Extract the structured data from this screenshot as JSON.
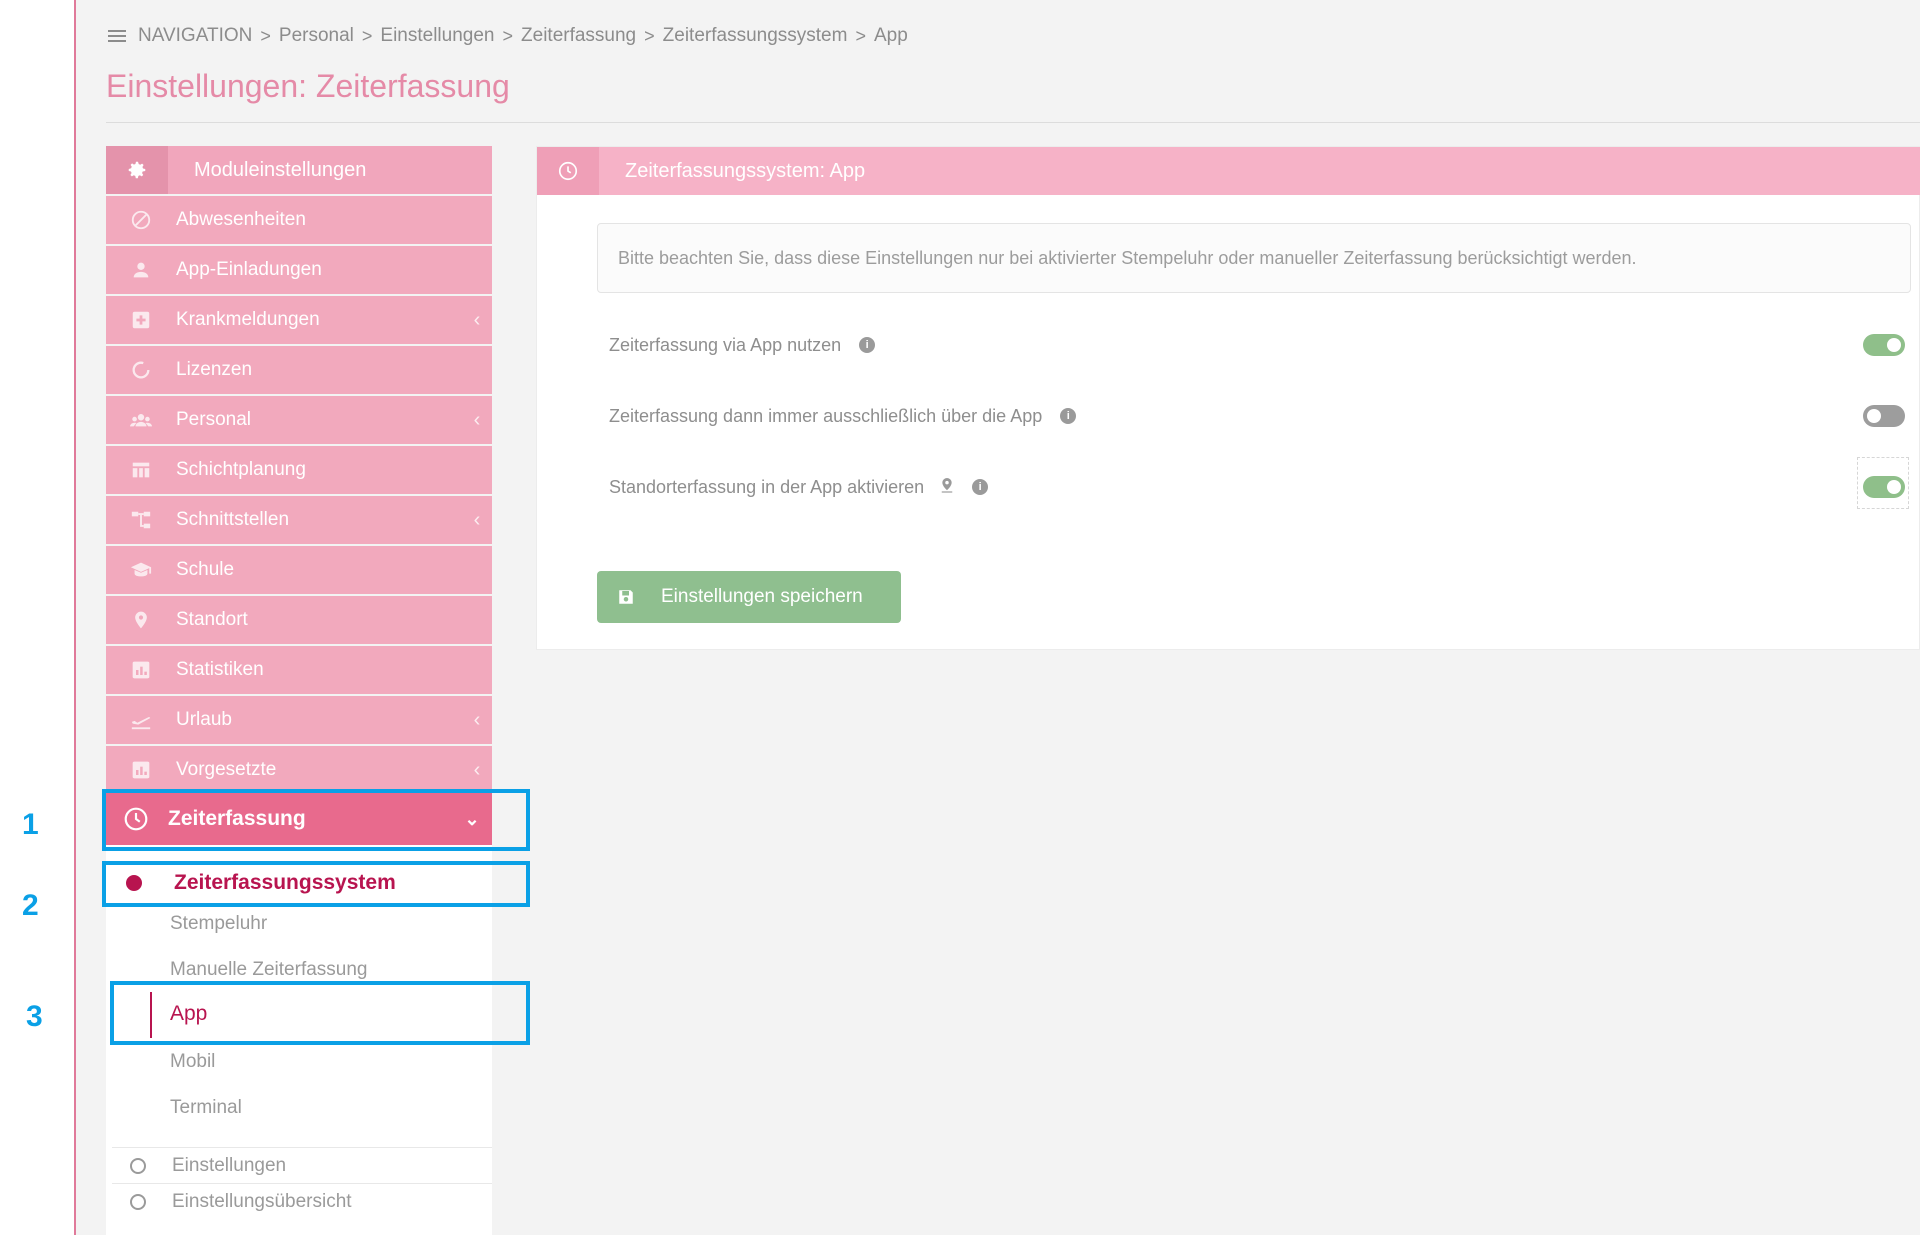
{
  "breadcrumb": {
    "items": [
      "NAVIGATION",
      "Personal",
      "Einstellungen",
      "Zeiterfassung",
      "Zeiterfassungssystem",
      "App"
    ],
    "separator": ">"
  },
  "page": {
    "title": "Einstellungen: Zeiterfassung"
  },
  "sidebar": {
    "header": "Moduleinstellungen",
    "items": [
      {
        "label": "Abwesenheiten",
        "icon": "slash-circle-icon",
        "has_submenu": false
      },
      {
        "label": "App-Einladungen",
        "icon": "user-icon",
        "has_submenu": false
      },
      {
        "label": "Krankmeldungen",
        "icon": "medical-plus-icon",
        "has_submenu": true
      },
      {
        "label": "Lizenzen",
        "icon": "circle-notch-icon",
        "has_submenu": false
      },
      {
        "label": "Personal",
        "icon": "users-icon",
        "has_submenu": true
      },
      {
        "label": "Schichtplanung",
        "icon": "calendar-grid-icon",
        "has_submenu": false
      },
      {
        "label": "Schnittstellen",
        "icon": "sitemap-icon",
        "has_submenu": true
      },
      {
        "label": "Schule",
        "icon": "graduation-cap-icon",
        "has_submenu": false
      },
      {
        "label": "Standort",
        "icon": "map-pin-icon",
        "has_submenu": false
      },
      {
        "label": "Statistiken",
        "icon": "bar-chart-icon",
        "has_submenu": false
      },
      {
        "label": "Urlaub",
        "icon": "plane-departure-icon",
        "has_submenu": true
      },
      {
        "label": "Vorgesetzte",
        "icon": "bar-chart-icon",
        "has_submenu": true
      }
    ],
    "chevron_left": "‹",
    "active": {
      "label": "Zeiterfassung",
      "icon": "clock-icon",
      "chevron": "⌄"
    },
    "submenu": {
      "system_label": "Zeiterfassungssystem",
      "leaves": [
        "Stempeluhr",
        "Manuelle Zeiterfassung",
        "App",
        "Mobil",
        "Terminal"
      ],
      "active_leaf": "App",
      "radio_items": [
        "Einstellungen",
        "Einstellungsübersicht"
      ]
    }
  },
  "panel": {
    "header": "Zeiterfassungssystem: App",
    "notice": "Bitte beachten Sie, dass diese Einstellungen nur bei aktivierter Stempeluhr oder manueller Zeiterfassung berücksichtigt werden.",
    "settings": [
      {
        "label": "Zeiterfassung via App nutzen",
        "enabled": true,
        "has_pin": false
      },
      {
        "label": "Zeiterfassung dann immer ausschließlich über die App",
        "enabled": false,
        "has_pin": false
      },
      {
        "label": "Standorterfassung in der App aktivieren",
        "enabled": true,
        "has_pin": true
      }
    ],
    "info_glyph": "i",
    "save_label": "Einstellungen speichern"
  },
  "annotations": {
    "numbers": [
      "1",
      "2",
      "3"
    ],
    "color": "#0aa0e6"
  },
  "colors": {
    "accent_pink": "#e86a8d",
    "active_text": "#b8144f",
    "toggle_on": "#8fbf8a",
    "save_green": "#8fbf8f"
  }
}
